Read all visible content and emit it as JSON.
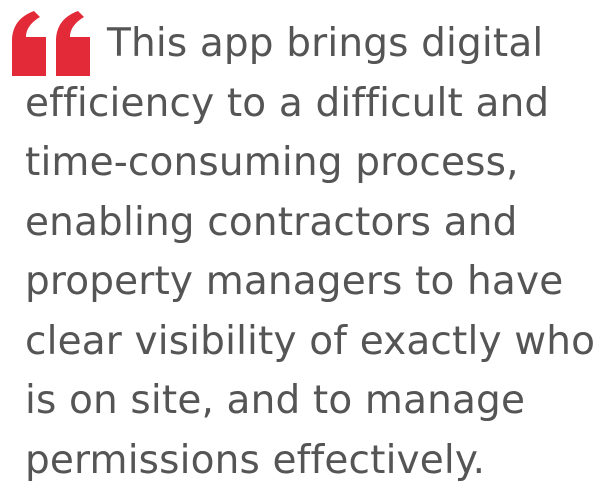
{
  "quote": {
    "lines": [
      "This app brings digital",
      "efficiency to a difficult and",
      "time-consuming process,",
      "enabling contractors and",
      "property managers to have",
      "clear visibility of exactly who",
      "is on site, and to manage",
      "permissions effectively."
    ],
    "mark_icon": "quote-mark-icon",
    "mark_color": "#e22a38",
    "text_color": "#555555"
  }
}
